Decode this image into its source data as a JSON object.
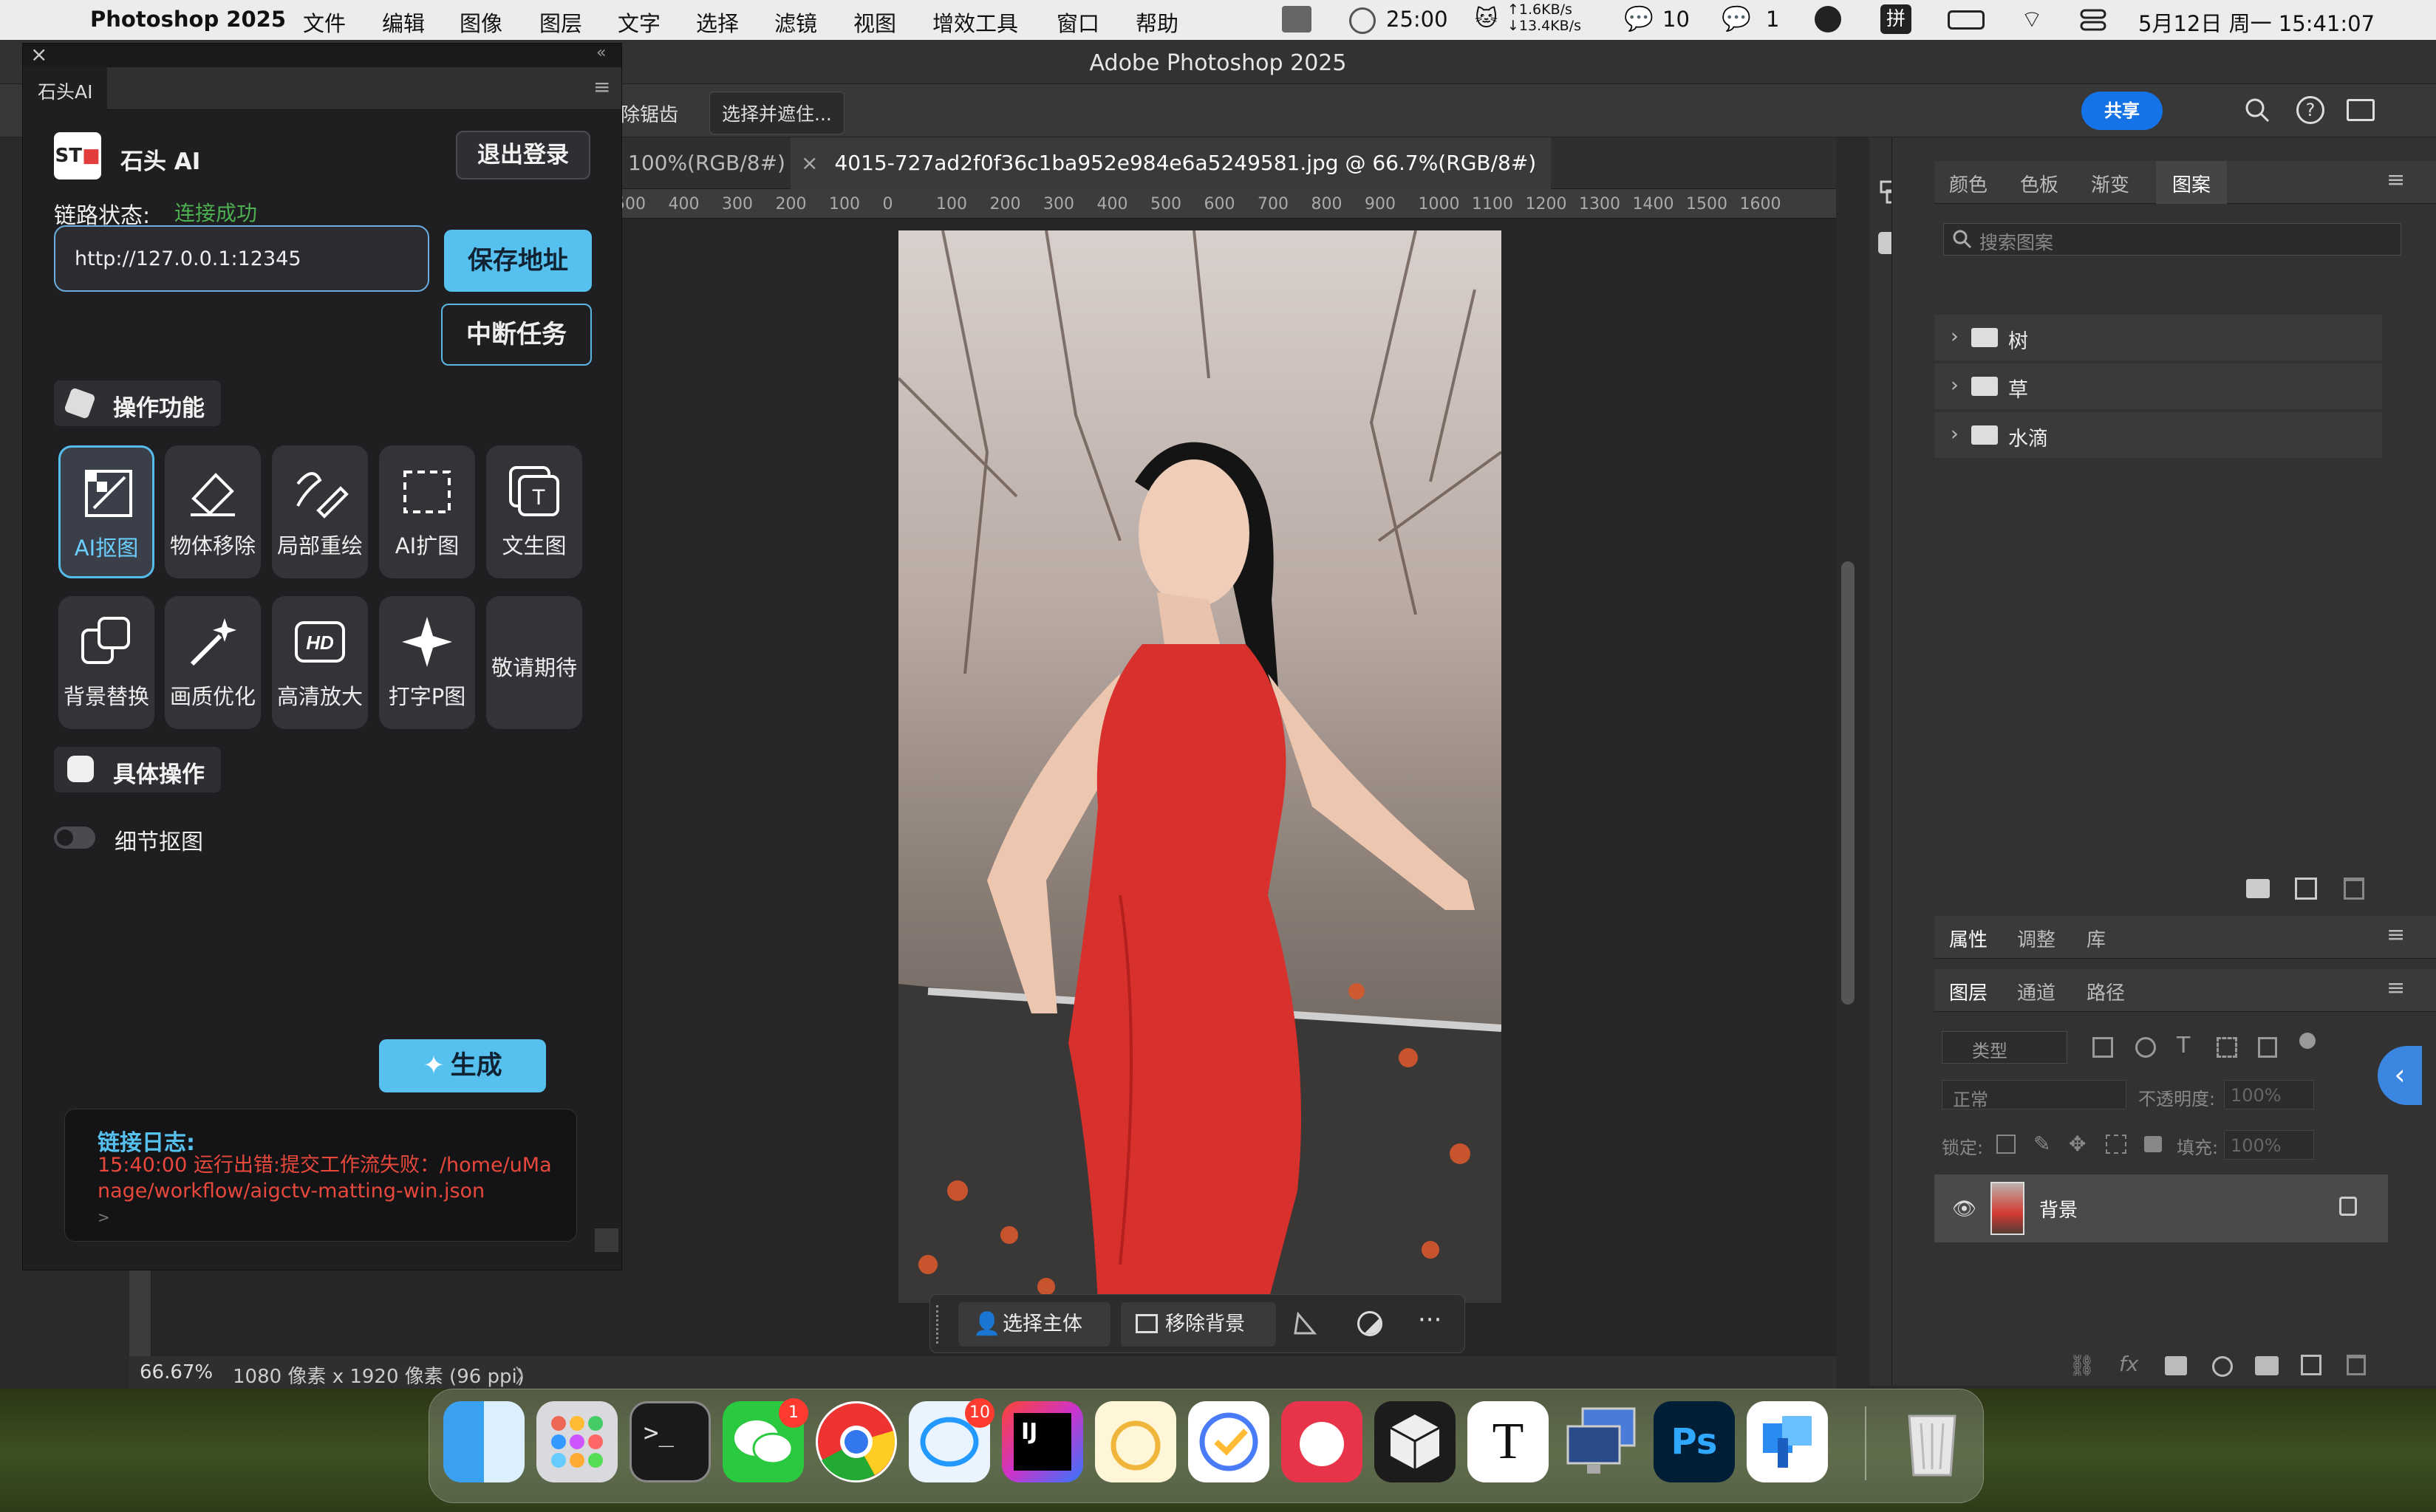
{
  "menubar": {
    "app_name": "Photoshop 2025",
    "items": [
      "文件",
      "编辑",
      "图像",
      "图层",
      "文字",
      "选择",
      "滤镜",
      "视图",
      "增效工具",
      "窗口",
      "帮助"
    ],
    "timer": "25:00",
    "net_up": "↑1.6KB/s",
    "net_down": "↓13.4KB/s",
    "chat_count": "10",
    "wechat_count": "1",
    "ime": "拼",
    "datetime": "5月12日 周一 15:41:07"
  },
  "window": {
    "title": "Adobe Photoshop 2025"
  },
  "options_bar": {
    "antialias_label": "除锯齿",
    "select_mask_label": "选择并遮住...",
    "share_label": "共享"
  },
  "doc_tabs": {
    "tab1": "100%(RGB/8#)",
    "tab2": "4015-727ad2f0f36c1ba952e984e6a5249581.jpg @ 66.7%(RGB/8#)",
    "close_glyph": "×"
  },
  "ruler_top": [
    "500",
    "400",
    "300",
    "200",
    "100",
    "0",
    "100",
    "200",
    "300",
    "400",
    "500",
    "600",
    "700",
    "800",
    "900",
    "1000",
    "1100",
    "1200",
    "1300",
    "1400",
    "1500",
    "1600"
  ],
  "statusbar": {
    "zoom": "66.67%",
    "info": "1080 像素 x 1920 像素 (96 ppi)",
    "arrow": "〉"
  },
  "context_bar": {
    "select_subject": "选择主体",
    "remove_bg": "移除背景",
    "more": "···"
  },
  "plugin": {
    "panel_title": "石头AI",
    "logo_text": "ST",
    "brand_name": "石头 AI",
    "logout_label": "退出登录",
    "link_status_label": "链路状态:",
    "link_status_value": "连接成功",
    "address_value": "http://127.0.0.1:12345",
    "save_address_label": "保存地址",
    "interrupt_label": "中断任务",
    "ops_section_label": "操作功能",
    "tools": [
      {
        "label": "AI抠图",
        "icon": "ai-matting-icon"
      },
      {
        "label": "物体移除",
        "icon": "eraser-icon"
      },
      {
        "label": "局部重绘",
        "icon": "brush-redraw-icon"
      },
      {
        "label": "AI扩图",
        "icon": "expand-frame-icon"
      },
      {
        "label": "文生图",
        "icon": "text-to-image-icon"
      },
      {
        "label": "背景替换",
        "icon": "bg-replace-icon"
      },
      {
        "label": "画质优化",
        "icon": "magic-wand-icon"
      },
      {
        "label": "高清放大",
        "icon": "hd-icon"
      },
      {
        "label": "打字P图",
        "icon": "sparkle-icon"
      },
      {
        "label": "敬请期待",
        "icon": ""
      }
    ],
    "detail_section_label": "具体操作",
    "detail_toggle_label": "细节抠图",
    "generate_label": "生成",
    "log_title": "链接日志:",
    "log_message": "15:40:00 运行出错:提交工作流失败：/home/uManage/workflow/aigctv-matting-win.json",
    "log_prompt": ">"
  },
  "right_panel": {
    "top_tabs": [
      "颜色",
      "色板",
      "渐变",
      "图案"
    ],
    "active_top_tab": "图案",
    "search_placeholder": "搜索图案",
    "pattern_groups": [
      "树",
      "草",
      "水滴"
    ],
    "prop_tabs": [
      "属性",
      "调整",
      "库"
    ],
    "layer_tabs": [
      "图层",
      "通道",
      "路径"
    ],
    "filter_placeholder": "类型",
    "blend_mode": "正常",
    "opacity_label": "不透明度:",
    "opacity_value": "100%",
    "lock_label": "锁定:",
    "fill_label": "填充:",
    "fill_value": "100%",
    "layer_name": "背景"
  },
  "dock": {
    "apps": [
      "Finder",
      "Launchpad",
      "Terminal",
      "WeChat",
      "Chrome",
      "QQ",
      "IntelliJ IDEA",
      "Cat",
      "Tick",
      "Bear",
      "Cube",
      "Typora",
      "Screen",
      "Photoshop",
      "Tools",
      "Trash"
    ],
    "wechat_badge": "1",
    "qq_badge": "10"
  },
  "colors": {
    "accent_blue": "#56c0ef",
    "status_green": "#4caf50",
    "error_red": "#ff3b30",
    "ps_share": "#1473e6"
  }
}
